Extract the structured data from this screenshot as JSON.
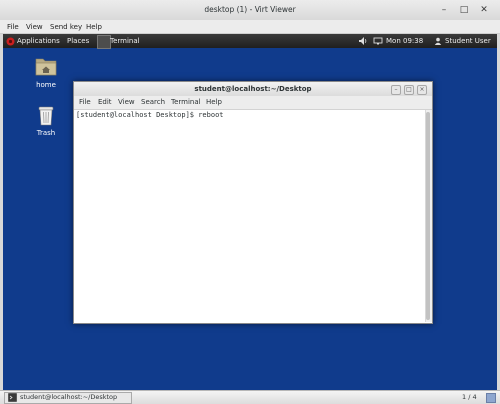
{
  "outer_window": {
    "title": "desktop (1) - Virt Viewer",
    "menu": [
      "File",
      "View",
      "Send key",
      "Help"
    ]
  },
  "top_bar": {
    "applications": "Applications",
    "places": "Places",
    "active_app": "Terminal",
    "clock": "Mon 09:38",
    "user": "Student User"
  },
  "desktop_icons": [
    {
      "label": "home"
    },
    {
      "label": "Trash"
    }
  ],
  "terminal": {
    "title": "student@localhost:~/Desktop",
    "menu": [
      "File",
      "Edit",
      "View",
      "Search",
      "Terminal",
      "Help"
    ],
    "prompt_line": "[student@localhost Desktop]$ reboot"
  },
  "taskbar": {
    "item_label": "student@localhost:~/Desktop",
    "pager": "1 / 4"
  },
  "colors": {
    "desktop_background": "#103b8c",
    "gnome_bar": "#262626"
  }
}
